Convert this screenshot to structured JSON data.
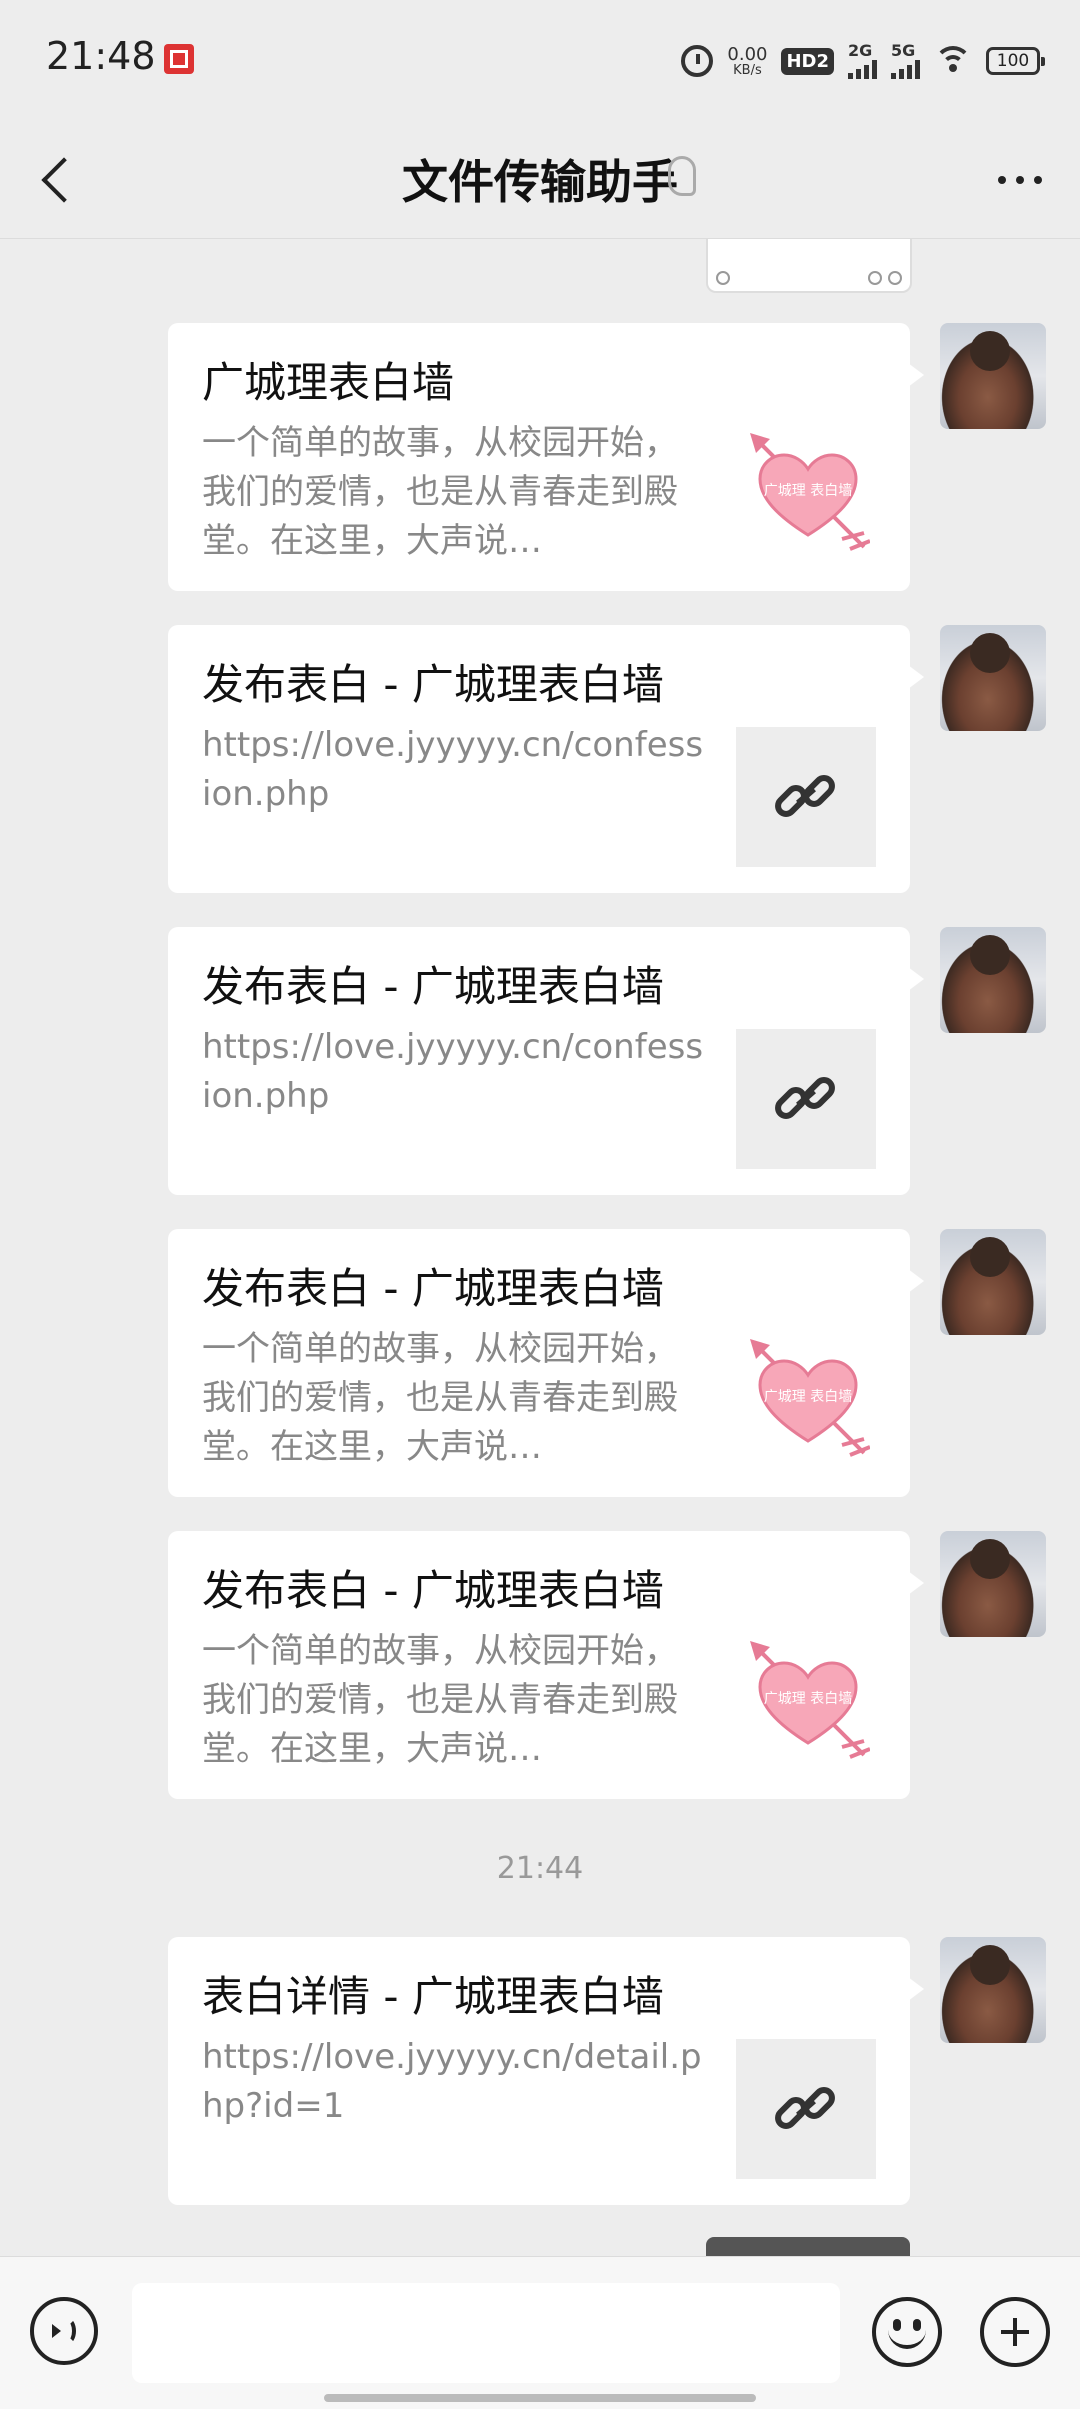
{
  "status_bar": {
    "time": "21:48",
    "net_speed_value": "0.00",
    "net_speed_unit": "KB/s",
    "hd_label": "HD2",
    "signal_1_label": "2G",
    "signal_2_label": "5G",
    "battery_level": "100"
  },
  "header": {
    "title": "文件传输助手"
  },
  "messages": [
    {
      "type": "card-heart",
      "title": "广城理表白墙",
      "description": "一个简单的故事，从校园开始，我们的爱情，也是从青春走到殿堂。在这里，大声说…",
      "heart_text": "广城理 表白墙"
    },
    {
      "type": "card-link",
      "title": "发布表白 - 广城理表白墙",
      "description": "https://love.jyyyyy.cn/confession.php"
    },
    {
      "type": "card-link",
      "title": "发布表白 - 广城理表白墙",
      "description": "https://love.jyyyyy.cn/confession.php"
    },
    {
      "type": "card-heart",
      "title": "发布表白 - 广城理表白墙",
      "description": "一个简单的故事，从校园开始，我们的爱情，也是从青春走到殿堂。在这里，大声说…",
      "heart_text": "广城理 表白墙"
    },
    {
      "type": "card-heart",
      "title": "发布表白 - 广城理表白墙",
      "description": "一个简单的故事，从校园开始，我们的爱情，也是从青春走到殿堂。在这里，大声说…",
      "heart_text": "广城理 表白墙"
    },
    {
      "type": "card-link",
      "title": "表白详情 - 广城理表白墙",
      "description": "https://love.jyyyyy.cn/detail.php?id=1"
    }
  ],
  "timestamp": "21:44",
  "input": {
    "placeholder": ""
  },
  "colors": {
    "background": "#ededed",
    "card": "#ffffff",
    "heart_fill": "#f7a7b8",
    "heart_stroke": "#e67b95",
    "description_text": "#888888"
  }
}
